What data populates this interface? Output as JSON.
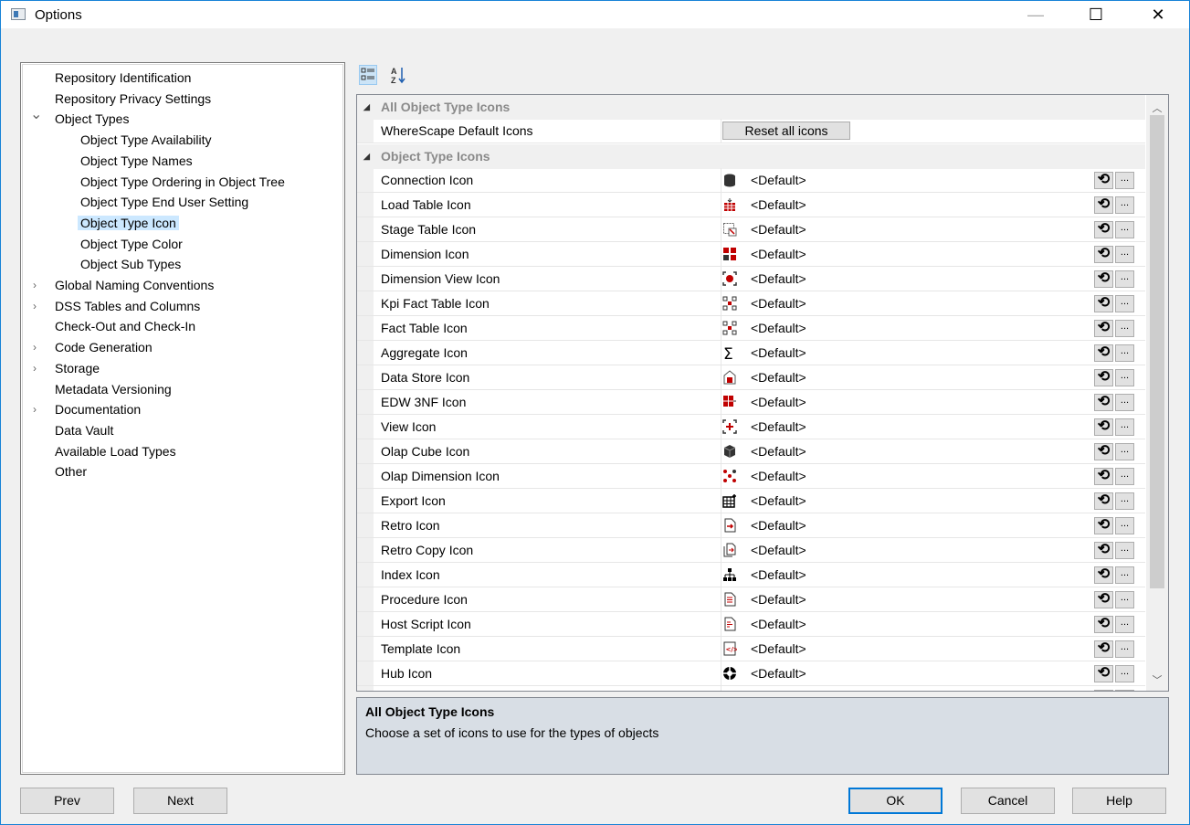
{
  "window": {
    "title": "Options",
    "minimize": "—",
    "maximize": "☐",
    "close": "✕"
  },
  "tree": [
    {
      "label": "Repository Identification",
      "level": 0,
      "chevron": ""
    },
    {
      "label": "Repository Privacy Settings",
      "level": 0,
      "chevron": ""
    },
    {
      "label": "Object Types",
      "level": 0,
      "chevron": "down"
    },
    {
      "label": "Object Type Availability",
      "level": 1,
      "chevron": ""
    },
    {
      "label": "Object Type Names",
      "level": 1,
      "chevron": ""
    },
    {
      "label": "Object Type Ordering in Object Tree",
      "level": 1,
      "chevron": ""
    },
    {
      "label": "Object Type End User Setting",
      "level": 1,
      "chevron": ""
    },
    {
      "label": "Object Type Icon",
      "level": 1,
      "chevron": "",
      "selected": true
    },
    {
      "label": "Object Type Color",
      "level": 1,
      "chevron": ""
    },
    {
      "label": "Object Sub Types",
      "level": 1,
      "chevron": ""
    },
    {
      "label": "Global Naming Conventions",
      "level": 0,
      "chevron": "right"
    },
    {
      "label": "DSS Tables and Columns",
      "level": 0,
      "chevron": "right"
    },
    {
      "label": "Check-Out and Check-In",
      "level": 0,
      "chevron": ""
    },
    {
      "label": "Code Generation",
      "level": 0,
      "chevron": "right"
    },
    {
      "label": "Storage",
      "level": 0,
      "chevron": "right"
    },
    {
      "label": "Metadata Versioning",
      "level": 0,
      "chevron": ""
    },
    {
      "label": "Documentation",
      "level": 0,
      "chevron": "right"
    },
    {
      "label": "Data Vault",
      "level": 0,
      "chevron": ""
    },
    {
      "label": "Available Load Types",
      "level": 0,
      "chevron": ""
    },
    {
      "label": "Other",
      "level": 0,
      "chevron": ""
    }
  ],
  "grid": {
    "category1": "All Object Type Icons",
    "default_icons_label": "WhereScape Default Icons",
    "reset_label": "Reset all icons",
    "category2": "Object Type Icons",
    "value_text": "<Default>",
    "dots": "...",
    "properties": [
      {
        "name": "Connection Icon",
        "icon": "cylinder-icon"
      },
      {
        "name": "Load Table Icon",
        "icon": "load-table-icon"
      },
      {
        "name": "Stage Table Icon",
        "icon": "stage-table-icon"
      },
      {
        "name": "Dimension Icon",
        "icon": "dimension-icon"
      },
      {
        "name": "Dimension View Icon",
        "icon": "dimension-view-icon"
      },
      {
        "name": "Kpi Fact Table Icon",
        "icon": "kpi-fact-icon"
      },
      {
        "name": "Fact Table Icon",
        "icon": "fact-table-icon"
      },
      {
        "name": "Aggregate Icon",
        "icon": "sigma-icon"
      },
      {
        "name": "Data Store Icon",
        "icon": "data-store-icon"
      },
      {
        "name": "EDW 3NF Icon",
        "icon": "edw-icon"
      },
      {
        "name": "View Icon",
        "icon": "view-icon"
      },
      {
        "name": "Olap Cube Icon",
        "icon": "cube-icon"
      },
      {
        "name": "Olap Dimension Icon",
        "icon": "olap-dimension-icon"
      },
      {
        "name": "Export Icon",
        "icon": "export-icon"
      },
      {
        "name": "Retro Icon",
        "icon": "retro-icon"
      },
      {
        "name": "Retro Copy Icon",
        "icon": "retro-copy-icon"
      },
      {
        "name": "Index Icon",
        "icon": "index-icon"
      },
      {
        "name": "Procedure Icon",
        "icon": "procedure-icon"
      },
      {
        "name": "Host Script Icon",
        "icon": "host-script-icon"
      },
      {
        "name": "Template Icon",
        "icon": "template-icon"
      },
      {
        "name": "Hub Icon",
        "icon": "hub-icon"
      }
    ]
  },
  "description": {
    "title": "All Object Type Icons",
    "text": "Choose a set of icons to use for the types of objects"
  },
  "buttons": {
    "prev": "Prev",
    "next": "Next",
    "ok": "OK",
    "cancel": "Cancel",
    "help": "Help"
  },
  "colors": {
    "selection": "#cce8ff",
    "accent": "#0078d7",
    "icon_red": "#c00000"
  }
}
